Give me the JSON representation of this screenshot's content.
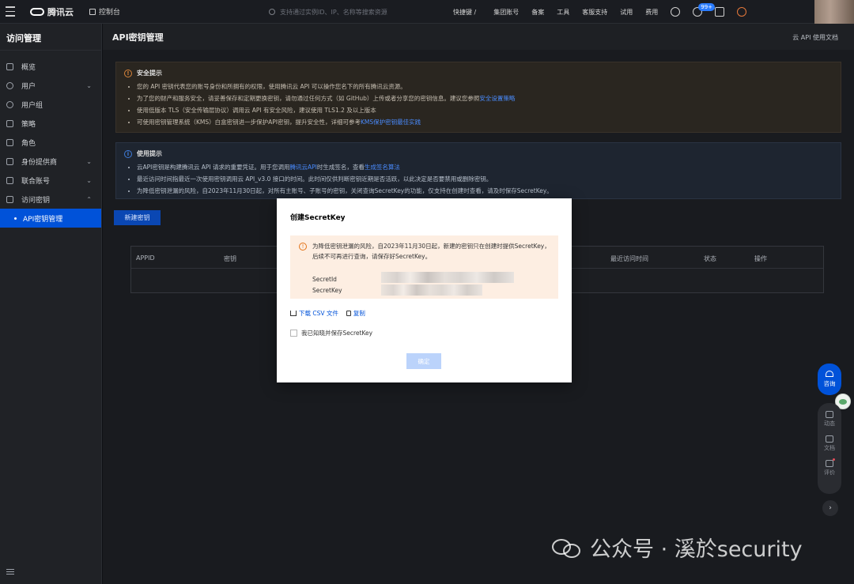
{
  "topbar": {
    "brand": "腾讯云",
    "console": "控制台",
    "search_placeholder": "支持通过实例ID、IP、名称等搜索资源",
    "shortcut": "快捷键 /",
    "items": [
      "集团账号",
      "备案",
      "工具",
      "客服支持",
      "试用",
      "费用"
    ],
    "badge": "99+"
  },
  "sidebar": {
    "title": "访问管理",
    "items": [
      {
        "label": "概览",
        "chevron": ""
      },
      {
        "label": "用户",
        "chevron": "⌄"
      },
      {
        "label": "用户组",
        "chevron": ""
      },
      {
        "label": "策略",
        "chevron": ""
      },
      {
        "label": "角色",
        "chevron": ""
      },
      {
        "label": "身份提供商",
        "chevron": "⌄"
      },
      {
        "label": "联合账号",
        "chevron": "⌄"
      },
      {
        "label": "访问密钥",
        "chevron": "⌃"
      }
    ],
    "active_sub": "API密钥管理"
  },
  "main": {
    "title": "API密钥管理",
    "api_doc": "云 API 使用文档",
    "security": {
      "title": "安全提示",
      "items": [
        "您的 API 密钥代表您的账号身份和所拥有的权限，使用腾讯云 API 可以操作您名下的所有腾讯云资源。",
        "为了您的财产和服务安全，请妥善保存和定期更换密钥，请勿通过任何方式（如 GitHub）上传或者分享您的密钥信息。建议您参照",
        "使用低版本 TLS（安全传输层协议）调用云 API 有安全风险，建议使用 TLS1.2 及以上版本",
        "可使用密钥管理系统（KMS）白盒密钥进一步保护API密钥，提升安全性，详细可参考"
      ],
      "link1": "安全设置策略",
      "link2": "KMS保护密钥最佳实践"
    },
    "usage": {
      "title": "使用提示",
      "items": [
        "云API密钥是构建腾讯云 API 请求的重要凭证。用于您调用",
        "最近访问时间指最近一次使用密钥调用云 API_v3.0 接口的时间。此时间仅供判断密钥近期是否活跃，以此决定是否要禁用或删除密钥。",
        "为降低密钥泄漏的风险，自2023年11月30日起，对所有主账号、子账号的密钥，关闭查询SecretKey的功能，仅支持在创建时查看，请及时保存SecretKey。"
      ],
      "link_api": "腾讯云API",
      "mid_text": "时生成签名，查看",
      "link_sign": "生成签名算法"
    },
    "new_button": "新建密钥",
    "table_headers": [
      "APPID",
      "密钥",
      "最近访问时间",
      "状态",
      "操作"
    ]
  },
  "modal": {
    "title": "创建SecretKey",
    "warning": "为降低密钥泄漏的风险，自2023年11月30日起，新建的密钥只在创建时提供SecretKey，后续不可再进行查询，请保存好SecretKey。",
    "secret_id_label": "SecretId",
    "secret_key_label": "SecretKey",
    "download_csv": "下载 CSV 文件",
    "copy": "复制",
    "checkbox_label": "我已知晓并保存SecretKey",
    "confirm": "确定"
  },
  "float_tools": {
    "consult": "咨询",
    "items": [
      "动态",
      "文档",
      "评价"
    ],
    "chevron": "›"
  },
  "watermark": "公众号 · 溪於security"
}
